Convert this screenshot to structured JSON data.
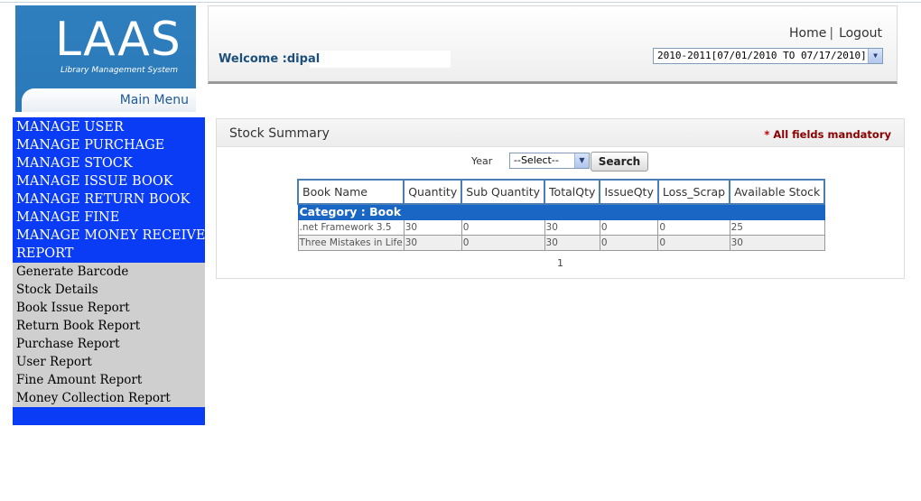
{
  "logo": {
    "text": "LAAS",
    "subtitle": "Library Management System",
    "menu_label": "Main Menu"
  },
  "header": {
    "welcome": "Welcome :dipal",
    "links": [
      "Home",
      "Logout"
    ],
    "year_selected": "2010-2011[07/01/2010 TO 07/17/2010]"
  },
  "sidebar": {
    "main_items": [
      "MANAGE USER",
      "MANAGE PURCHAGE",
      "MANAGE STOCK",
      "MANAGE ISSUE BOOK",
      "MANAGE RETURN BOOK",
      "MANAGE FINE",
      "MANAGE MONEY RECEIVE",
      "REPORT"
    ],
    "report_items": [
      "Generate Barcode",
      "Stock Details",
      "Book Issue Report",
      "Return Book Report",
      "Purchase Report",
      "User Report",
      "Fine Amount Report",
      "Money Collection Report"
    ]
  },
  "panel": {
    "title": "Stock Summary",
    "mandatory": "All fields mandatory",
    "filter_label": "Year",
    "filter_selected": "--Select--",
    "search_label": "Search",
    "columns": [
      "Book Name",
      "Quantity",
      "Sub Quantity",
      "TotalQty",
      "IssueQty",
      "Loss_Scrap",
      "Available Stock"
    ],
    "category": "Category : Book",
    "rows": [
      [
        ".net Framework 3.5",
        "30",
        "0",
        "30",
        "0",
        "0",
        "25"
      ],
      [
        "Three Mistakes in Life",
        "30",
        "0",
        "30",
        "0",
        "0",
        "30"
      ]
    ],
    "page": "1"
  },
  "colors": {
    "menu_blue": "#0a3cf5",
    "category_blue": "#1a66c4",
    "logo_blue": "#2f7fbf"
  }
}
